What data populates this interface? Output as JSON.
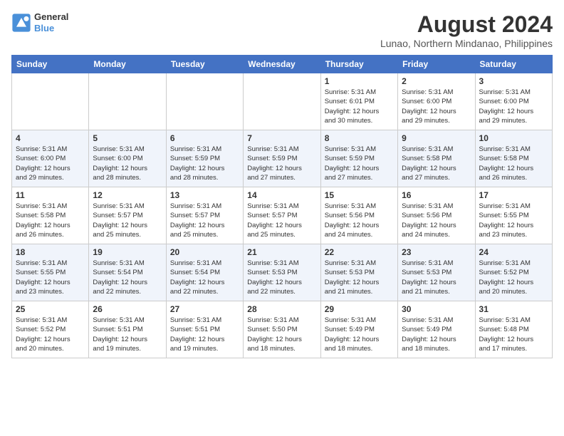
{
  "header": {
    "logo_line1": "General",
    "logo_line2": "Blue",
    "month_year": "August 2024",
    "location": "Lunao, Northern Mindanao, Philippines"
  },
  "days_of_week": [
    "Sunday",
    "Monday",
    "Tuesday",
    "Wednesday",
    "Thursday",
    "Friday",
    "Saturday"
  ],
  "weeks": [
    [
      {
        "day": "",
        "info": ""
      },
      {
        "day": "",
        "info": ""
      },
      {
        "day": "",
        "info": ""
      },
      {
        "day": "",
        "info": ""
      },
      {
        "day": "1",
        "info": "Sunrise: 5:31 AM\nSunset: 6:01 PM\nDaylight: 12 hours\nand 30 minutes."
      },
      {
        "day": "2",
        "info": "Sunrise: 5:31 AM\nSunset: 6:00 PM\nDaylight: 12 hours\nand 29 minutes."
      },
      {
        "day": "3",
        "info": "Sunrise: 5:31 AM\nSunset: 6:00 PM\nDaylight: 12 hours\nand 29 minutes."
      }
    ],
    [
      {
        "day": "4",
        "info": "Sunrise: 5:31 AM\nSunset: 6:00 PM\nDaylight: 12 hours\nand 29 minutes."
      },
      {
        "day": "5",
        "info": "Sunrise: 5:31 AM\nSunset: 6:00 PM\nDaylight: 12 hours\nand 28 minutes."
      },
      {
        "day": "6",
        "info": "Sunrise: 5:31 AM\nSunset: 5:59 PM\nDaylight: 12 hours\nand 28 minutes."
      },
      {
        "day": "7",
        "info": "Sunrise: 5:31 AM\nSunset: 5:59 PM\nDaylight: 12 hours\nand 27 minutes."
      },
      {
        "day": "8",
        "info": "Sunrise: 5:31 AM\nSunset: 5:59 PM\nDaylight: 12 hours\nand 27 minutes."
      },
      {
        "day": "9",
        "info": "Sunrise: 5:31 AM\nSunset: 5:58 PM\nDaylight: 12 hours\nand 27 minutes."
      },
      {
        "day": "10",
        "info": "Sunrise: 5:31 AM\nSunset: 5:58 PM\nDaylight: 12 hours\nand 26 minutes."
      }
    ],
    [
      {
        "day": "11",
        "info": "Sunrise: 5:31 AM\nSunset: 5:58 PM\nDaylight: 12 hours\nand 26 minutes."
      },
      {
        "day": "12",
        "info": "Sunrise: 5:31 AM\nSunset: 5:57 PM\nDaylight: 12 hours\nand 25 minutes."
      },
      {
        "day": "13",
        "info": "Sunrise: 5:31 AM\nSunset: 5:57 PM\nDaylight: 12 hours\nand 25 minutes."
      },
      {
        "day": "14",
        "info": "Sunrise: 5:31 AM\nSunset: 5:57 PM\nDaylight: 12 hours\nand 25 minutes."
      },
      {
        "day": "15",
        "info": "Sunrise: 5:31 AM\nSunset: 5:56 PM\nDaylight: 12 hours\nand 24 minutes."
      },
      {
        "day": "16",
        "info": "Sunrise: 5:31 AM\nSunset: 5:56 PM\nDaylight: 12 hours\nand 24 minutes."
      },
      {
        "day": "17",
        "info": "Sunrise: 5:31 AM\nSunset: 5:55 PM\nDaylight: 12 hours\nand 23 minutes."
      }
    ],
    [
      {
        "day": "18",
        "info": "Sunrise: 5:31 AM\nSunset: 5:55 PM\nDaylight: 12 hours\nand 23 minutes."
      },
      {
        "day": "19",
        "info": "Sunrise: 5:31 AM\nSunset: 5:54 PM\nDaylight: 12 hours\nand 22 minutes."
      },
      {
        "day": "20",
        "info": "Sunrise: 5:31 AM\nSunset: 5:54 PM\nDaylight: 12 hours\nand 22 minutes."
      },
      {
        "day": "21",
        "info": "Sunrise: 5:31 AM\nSunset: 5:53 PM\nDaylight: 12 hours\nand 22 minutes."
      },
      {
        "day": "22",
        "info": "Sunrise: 5:31 AM\nSunset: 5:53 PM\nDaylight: 12 hours\nand 21 minutes."
      },
      {
        "day": "23",
        "info": "Sunrise: 5:31 AM\nSunset: 5:53 PM\nDaylight: 12 hours\nand 21 minutes."
      },
      {
        "day": "24",
        "info": "Sunrise: 5:31 AM\nSunset: 5:52 PM\nDaylight: 12 hours\nand 20 minutes."
      }
    ],
    [
      {
        "day": "25",
        "info": "Sunrise: 5:31 AM\nSunset: 5:52 PM\nDaylight: 12 hours\nand 20 minutes."
      },
      {
        "day": "26",
        "info": "Sunrise: 5:31 AM\nSunset: 5:51 PM\nDaylight: 12 hours\nand 19 minutes."
      },
      {
        "day": "27",
        "info": "Sunrise: 5:31 AM\nSunset: 5:51 PM\nDaylight: 12 hours\nand 19 minutes."
      },
      {
        "day": "28",
        "info": "Sunrise: 5:31 AM\nSunset: 5:50 PM\nDaylight: 12 hours\nand 18 minutes."
      },
      {
        "day": "29",
        "info": "Sunrise: 5:31 AM\nSunset: 5:49 PM\nDaylight: 12 hours\nand 18 minutes."
      },
      {
        "day": "30",
        "info": "Sunrise: 5:31 AM\nSunset: 5:49 PM\nDaylight: 12 hours\nand 18 minutes."
      },
      {
        "day": "31",
        "info": "Sunrise: 5:31 AM\nSunset: 5:48 PM\nDaylight: 12 hours\nand 17 minutes."
      }
    ]
  ]
}
